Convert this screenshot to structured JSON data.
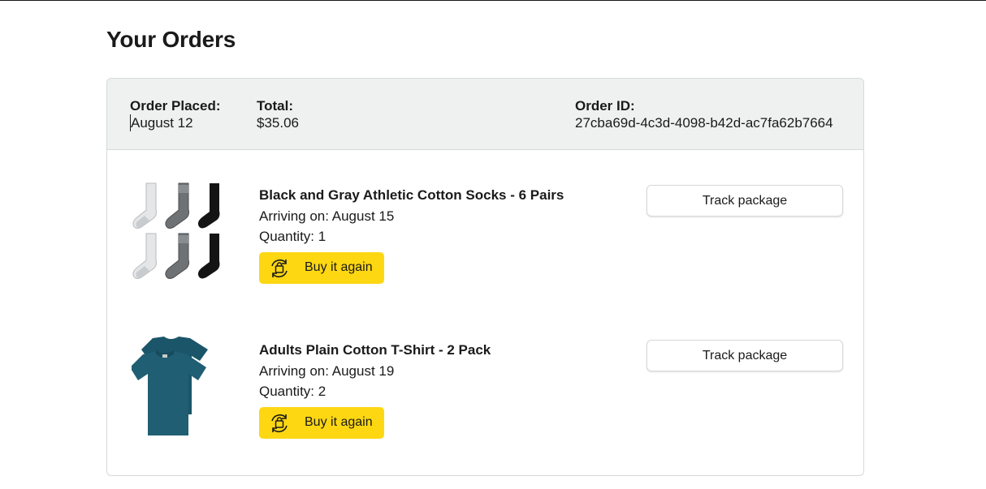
{
  "page": {
    "title": "Your Orders"
  },
  "order": {
    "placed_label": "Order Placed:",
    "placed_value": "August 12",
    "total_label": "Total:",
    "total_value": "$35.06",
    "id_label": "Order ID:",
    "id_value": "27cba69d-4c3d-4098-b42d-ac7fa62b7664"
  },
  "items": [
    {
      "title": "Black and Gray Athletic Cotton Socks - 6 Pairs",
      "arriving": "Arriving on: August 15",
      "quantity": "Quantity: 1",
      "buy_label": "Buy it again",
      "track_label": "Track package",
      "image": "socks-image"
    },
    {
      "title": "Adults Plain Cotton T-Shirt - 2 Pack",
      "arriving": "Arriving on: August 19",
      "quantity": "Quantity: 2",
      "buy_label": "Buy it again",
      "track_label": "Track package",
      "image": "tshirt-image"
    }
  ],
  "colors": {
    "buy_button": "#fdd712",
    "header_bg": "#eff1f0",
    "border": "#d6d8da",
    "tshirt": "#1f5e73"
  }
}
